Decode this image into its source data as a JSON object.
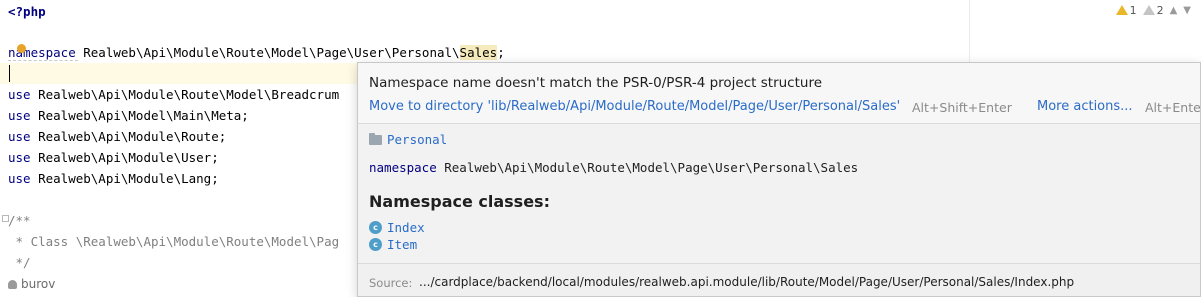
{
  "editor": {
    "lines": {
      "php_open": "<?php",
      "ns_keyword": "namespace",
      "ns_path": " Realweb\\Api\\Module\\Route\\Model\\Page\\User\\Personal\\",
      "ns_last": "Sales",
      "ns_semicolon": ";",
      "use_keyword": "use",
      "use1": " Realweb\\Api\\Module\\Route\\Model\\Breadcrum",
      "use2": " Realweb\\Api\\Model\\Main\\Meta;",
      "use3": " Realweb\\Api\\Module\\Route;",
      "use4": " Realweb\\Api\\Module\\User;",
      "use5": " Realweb\\Api\\Module\\Lang;",
      "doc_open": "/**",
      "doc_class": " * Class \\Realweb\\Api\\Module\\Route\\Model\\Pag",
      "doc_close": " */"
    },
    "author": "burov"
  },
  "inspections": {
    "warnings": "1",
    "weak_warnings": "2"
  },
  "popup": {
    "message": "Namespace name doesn't match the PSR-0/PSR-4 project structure",
    "fix_label": "Move to directory 'lib/Realweb/Api/Module/Route/Model/Page/User/Personal/Sales'",
    "fix_shortcut": "Alt+Shift+Enter",
    "more_label": "More actions...",
    "more_shortcut": "Alt+Enter",
    "folder": "Personal",
    "decl_keyword": "namespace",
    "decl_name": " Realweb\\Api\\Module\\Route\\Model\\Page\\User\\Personal\\Sales",
    "classes_heading": "Namespace classes:",
    "class_badge": "c",
    "classes": [
      "Index",
      "Item"
    ],
    "source_label": "Source:",
    "source_path": ".../cardplace/backend/local/modules/realweb.api.module/lib/Route/Model/Page/User/Personal/Sales/Index.php"
  },
  "colors": {
    "keyword": "#000080",
    "link": "#2a6cc7",
    "warning": "#e8b72a",
    "caret_line": "#fffae3"
  }
}
